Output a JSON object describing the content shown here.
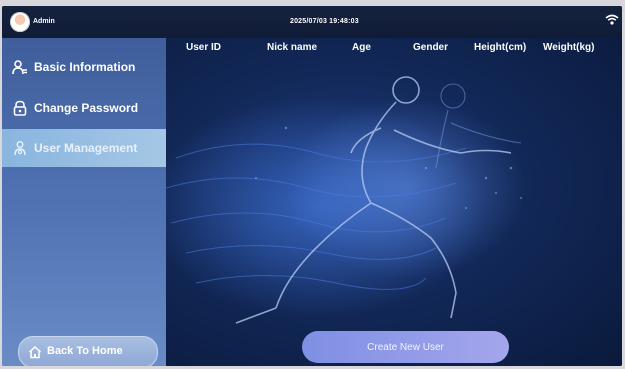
{
  "topbar": {
    "user": "Admin",
    "datetime": "2025/07/03 19:48:03"
  },
  "sidebar": {
    "items": [
      {
        "label": "Basic Information",
        "icon": "user-icon"
      },
      {
        "label": "Change Password",
        "icon": "lock-icon"
      },
      {
        "label": "User Management",
        "icon": "users-icon",
        "active": true
      }
    ],
    "back_label": "Back To Home"
  },
  "table": {
    "columns": [
      "User ID",
      "Nick name",
      "Age",
      "Gender",
      "Height(cm)",
      "Weight(kg)"
    ]
  },
  "actions": {
    "create_label": "Create New User"
  },
  "colors": {
    "sidebar": "#4a6aab",
    "active_item": "#8fb8e0",
    "content_bg": "#122858",
    "create_button": "#8f98e8"
  }
}
